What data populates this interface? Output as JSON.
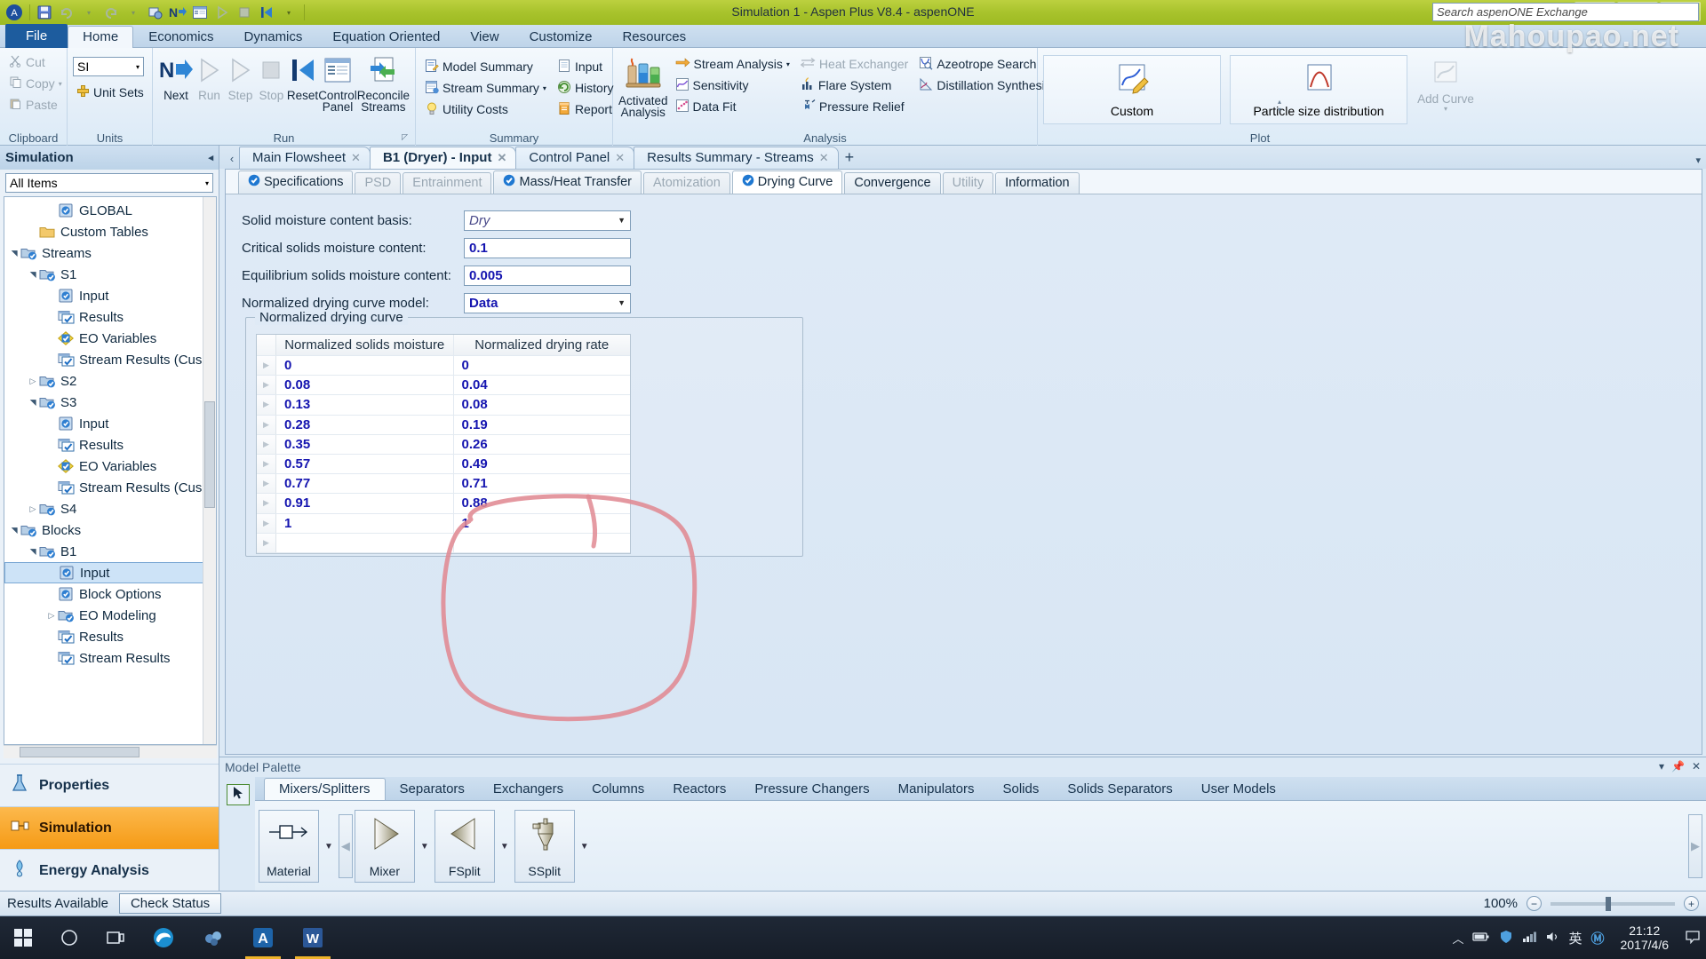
{
  "window": {
    "title": "Simulation 1 - Aspen Plus V8.4 - aspenONE",
    "minimize": "–",
    "maximize": "▢",
    "close": "✕",
    "watermark": "Mahoupao.net"
  },
  "quick_access": [
    {
      "name": "aspen-logo-icon",
      "glyph": "A"
    },
    {
      "name": "save-icon",
      "glyph": "▤"
    },
    {
      "name": "undo-icon",
      "glyph": "↺"
    },
    {
      "name": "redo-icon",
      "glyph": "↻"
    },
    {
      "name": "settings-icon",
      "glyph": "⚙"
    },
    {
      "name": "next-icon",
      "glyph": "N"
    },
    {
      "name": "control-panel-icon",
      "glyph": "▦"
    },
    {
      "name": "run-icon",
      "glyph": "▷"
    },
    {
      "name": "stop-icon",
      "glyph": "■"
    },
    {
      "name": "reset-icon",
      "glyph": "◀"
    },
    {
      "name": "qat-dropdown-icon",
      "glyph": "▾"
    }
  ],
  "ribbon": {
    "tabs": [
      {
        "label": "File",
        "state": "file"
      },
      {
        "label": "Home",
        "state": "active"
      },
      {
        "label": "Economics",
        "state": "normal"
      },
      {
        "label": "Dynamics",
        "state": "normal"
      },
      {
        "label": "Equation Oriented",
        "state": "normal"
      },
      {
        "label": "View",
        "state": "normal"
      },
      {
        "label": "Customize",
        "state": "normal"
      },
      {
        "label": "Resources",
        "state": "normal"
      }
    ],
    "search_placeholder": "Search aspenONE Exchange",
    "groups": {
      "clipboard": {
        "label": "Clipboard",
        "items": [
          {
            "label": "Cut",
            "icon": "scissors-icon",
            "dim": true
          },
          {
            "label": "Copy",
            "icon": "copy-icon",
            "dim": true,
            "dropdown": true
          },
          {
            "label": "Paste",
            "icon": "paste-icon",
            "dim": true
          }
        ]
      },
      "units": {
        "label": "Units",
        "unit_set": "SI",
        "unit_sets_label": "Unit Sets"
      },
      "run": {
        "label": "Run",
        "buttons": [
          {
            "label": "Next",
            "icon": "next-arrow-icon",
            "dim": false
          },
          {
            "label": "Run",
            "icon": "play-icon",
            "dim": true
          },
          {
            "label": "Step",
            "icon": "step-icon",
            "dim": true
          },
          {
            "label": "Stop",
            "icon": "stop-icon",
            "dim": true
          },
          {
            "label": "Reset",
            "icon": "reset-icon",
            "dim": false
          },
          {
            "label": "Control Panel",
            "icon": "control-panel-icon",
            "dim": false
          },
          {
            "label": "Reconcile Streams",
            "icon": "reconcile-icon",
            "dim": false
          }
        ]
      },
      "summary": {
        "label": "Summary",
        "col1": [
          {
            "label": "Model Summary",
            "icon": "model-summary-icon"
          },
          {
            "label": "Stream Summary",
            "icon": "stream-summary-icon",
            "dropdown": true
          },
          {
            "label": "Utility Costs",
            "icon": "utility-costs-icon"
          }
        ],
        "col2": [
          {
            "label": "Input",
            "icon": "input-icon"
          },
          {
            "label": "History",
            "icon": "history-icon"
          },
          {
            "label": "Report",
            "icon": "report-icon"
          }
        ]
      },
      "analysis": {
        "label": "Analysis",
        "activated": {
          "label": "Activated Analysis",
          "icon": "activated-analysis-icon"
        },
        "col1": [
          {
            "label": "Stream Analysis",
            "icon": "stream-analysis-icon",
            "dropdown": true,
            "dim": false
          },
          {
            "label": "Sensitivity",
            "icon": "sensitivity-icon",
            "dim": false
          },
          {
            "label": "Data Fit",
            "icon": "data-fit-icon",
            "dim": false
          }
        ],
        "col2": [
          {
            "label": "Heat Exchanger",
            "icon": "heat-exchanger-icon",
            "dim": true
          },
          {
            "label": "Flare System",
            "icon": "flare-system-icon",
            "dim": false
          },
          {
            "label": "Pressure Relief",
            "icon": "pressure-relief-icon",
            "dim": false
          }
        ],
        "col3": [
          {
            "label": "Azeotrope Search",
            "icon": "azeotrope-search-icon",
            "dim": false
          },
          {
            "label": "Distillation Synthesis",
            "icon": "distillation-synthesis-icon",
            "dim": false
          }
        ]
      },
      "plot": {
        "label": "Plot",
        "buttons": [
          {
            "label": "Custom",
            "icon": "custom-plot-icon"
          },
          {
            "label": "Particle size distribution",
            "icon": "psd-plot-icon"
          },
          {
            "label": "Add Curve",
            "icon": "add-curve-icon",
            "dim": true,
            "dropdown": true
          }
        ]
      }
    }
  },
  "navigation": {
    "header": "Simulation",
    "filter_value": "All Items",
    "tree": [
      {
        "label": "GLOBAL",
        "indent": 3,
        "icon": "form-icon",
        "twist": "none"
      },
      {
        "label": "Custom Tables",
        "indent": 2,
        "icon": "folder-icon",
        "twist": "none"
      },
      {
        "label": "Streams",
        "indent": 1,
        "icon": "folder-check-icon",
        "twist": "open"
      },
      {
        "label": "S1",
        "indent": 2,
        "icon": "folder-check-icon",
        "twist": "open"
      },
      {
        "label": "Input",
        "indent": 3,
        "icon": "form-icon",
        "twist": "none"
      },
      {
        "label": "Results",
        "indent": 3,
        "icon": "results-icon",
        "twist": "none"
      },
      {
        "label": "EO Variables",
        "indent": 3,
        "icon": "eo-variables-icon",
        "twist": "none"
      },
      {
        "label": "Stream Results (Cus",
        "indent": 3,
        "icon": "results-icon",
        "twist": "none"
      },
      {
        "label": "S2",
        "indent": 2,
        "icon": "folder-check-icon",
        "twist": "closed"
      },
      {
        "label": "S3",
        "indent": 2,
        "icon": "folder-check-icon",
        "twist": "open"
      },
      {
        "label": "Input",
        "indent": 3,
        "icon": "form-icon",
        "twist": "none"
      },
      {
        "label": "Results",
        "indent": 3,
        "icon": "results-icon",
        "twist": "none"
      },
      {
        "label": "EO Variables",
        "indent": 3,
        "icon": "eo-variables-icon",
        "twist": "none"
      },
      {
        "label": "Stream Results (Cus",
        "indent": 3,
        "icon": "results-icon",
        "twist": "none"
      },
      {
        "label": "S4",
        "indent": 2,
        "icon": "folder-check-icon",
        "twist": "closed"
      },
      {
        "label": "Blocks",
        "indent": 1,
        "icon": "folder-check-icon",
        "twist": "open"
      },
      {
        "label": "B1",
        "indent": 2,
        "icon": "folder-check-icon",
        "twist": "open"
      },
      {
        "label": "Input",
        "indent": 3,
        "icon": "form-icon",
        "twist": "none",
        "selected": true
      },
      {
        "label": "Block Options",
        "indent": 3,
        "icon": "form-icon",
        "twist": "none"
      },
      {
        "label": "EO Modeling",
        "indent": 3,
        "icon": "folder-check-icon",
        "twist": "closed"
      },
      {
        "label": "Results",
        "indent": 3,
        "icon": "results-icon",
        "twist": "none"
      },
      {
        "label": "Stream Results",
        "indent": 3,
        "icon": "results-icon",
        "twist": "none"
      }
    ],
    "mode_buttons": [
      {
        "label": "Properties",
        "icon": "properties-flask-icon",
        "active": false
      },
      {
        "label": "Simulation",
        "icon": "simulation-icon",
        "active": true
      },
      {
        "label": "Energy Analysis",
        "icon": "energy-analysis-icon",
        "active": false
      }
    ]
  },
  "document_tabs": [
    {
      "label": "Main Flowsheet",
      "active": false
    },
    {
      "label": "B1 (Dryer) - Input",
      "active": true
    },
    {
      "label": "Control Panel",
      "active": false
    },
    {
      "label": "Results Summary - Streams",
      "active": false
    }
  ],
  "document_tabs_add": "+",
  "inner_tabs": [
    {
      "label": "Specifications",
      "status": "check",
      "state": "normal"
    },
    {
      "label": "PSD",
      "status": "none",
      "state": "disabled"
    },
    {
      "label": "Entrainment",
      "status": "none",
      "state": "disabled"
    },
    {
      "label": "Mass/Heat Transfer",
      "status": "check",
      "state": "normal"
    },
    {
      "label": "Atomization",
      "status": "none",
      "state": "disabled"
    },
    {
      "label": "Drying Curve",
      "status": "check",
      "state": "active"
    },
    {
      "label": "Convergence",
      "status": "none",
      "state": "normal"
    },
    {
      "label": "Utility",
      "status": "none",
      "state": "disabled"
    },
    {
      "label": "Information",
      "status": "none",
      "state": "normal"
    }
  ],
  "form": {
    "fields": [
      {
        "label": "Solid moisture content basis:",
        "value": "Dry",
        "type": "combo",
        "style": "italic"
      },
      {
        "label": "Critical solids moisture content:",
        "value": "0.1",
        "type": "text",
        "style": "bold"
      },
      {
        "label": "Equilibrium solids moisture content:",
        "value": "0.005",
        "type": "text",
        "style": "bold"
      },
      {
        "label": "Normalized drying curve model:",
        "value": "Data",
        "type": "combo",
        "style": "bold"
      }
    ],
    "group_title": "Normalized drying curve"
  },
  "chart_data": {
    "type": "table",
    "title": "Normalized drying curve",
    "columns": [
      "Normalized solids moisture",
      "Normalized drying rate"
    ],
    "xlabel": "Normalized solids moisture",
    "ylabel": "Normalized drying rate",
    "x": [
      0,
      0.08,
      0.13,
      0.28,
      0.35,
      0.57,
      0.77,
      0.91,
      1
    ],
    "y": [
      0,
      0.04,
      0.08,
      0.19,
      0.26,
      0.49,
      0.71,
      0.88,
      1
    ],
    "rows": [
      [
        "0",
        "0"
      ],
      [
        "0.08",
        "0.04"
      ],
      [
        "0.13",
        "0.08"
      ],
      [
        "0.28",
        "0.19"
      ],
      [
        "0.35",
        "0.26"
      ],
      [
        "0.57",
        "0.49"
      ],
      [
        "0.77",
        "0.71"
      ],
      [
        "0.91",
        "0.88"
      ],
      [
        "1",
        "1"
      ],
      [
        "",
        ""
      ]
    ]
  },
  "palette": {
    "header": "Model Palette",
    "tabs": [
      {
        "label": "Mixers/Splitters",
        "active": true
      },
      {
        "label": "Separators",
        "active": false
      },
      {
        "label": "Exchangers",
        "active": false
      },
      {
        "label": "Columns",
        "active": false
      },
      {
        "label": "Reactors",
        "active": false
      },
      {
        "label": "Pressure Changers",
        "active": false
      },
      {
        "label": "Manipulators",
        "active": false
      },
      {
        "label": "Solids",
        "active": false
      },
      {
        "label": "Solids Separators",
        "active": false
      },
      {
        "label": "User Models",
        "active": false
      }
    ],
    "items": [
      {
        "label": "Material",
        "icon": "material-stream-icon"
      },
      {
        "label": "Mixer",
        "icon": "mixer-icon"
      },
      {
        "label": "FSplit",
        "icon": "fsplit-icon"
      },
      {
        "label": "SSplit",
        "icon": "ssplit-icon"
      }
    ],
    "pointer_tool": "pointer-icon"
  },
  "status_bar": {
    "message": "Results Available",
    "check_status_label": "Check Status",
    "zoom_level": "100%",
    "zoom_out": "−",
    "zoom_in": "+"
  },
  "taskbar": {
    "start": "start-icon",
    "search": "search-circle-icon",
    "task_view": "task-view-icon",
    "apps": [
      {
        "name": "edge-icon",
        "glyph": "e"
      },
      {
        "name": "aspen-properties-icon",
        "glyph": "◍"
      },
      {
        "name": "aspen-plus-icon",
        "glyph": "A",
        "active": true
      },
      {
        "name": "word-icon",
        "glyph": "W",
        "active": true
      }
    ],
    "tray": [
      {
        "name": "show-hidden-icons",
        "glyph": "︿"
      },
      {
        "name": "battery-icon",
        "glyph": "▭"
      },
      {
        "name": "shield-icon",
        "glyph": "🛡"
      },
      {
        "name": "network-icon",
        "glyph": "▚"
      },
      {
        "name": "volume-icon",
        "glyph": "🔊"
      },
      {
        "name": "ime-language",
        "glyph": "英"
      },
      {
        "name": "ime-mode",
        "glyph": "M"
      }
    ],
    "clock_time": "21:12",
    "clock_date": "2017/4/6",
    "action-center": "notification-icon"
  }
}
